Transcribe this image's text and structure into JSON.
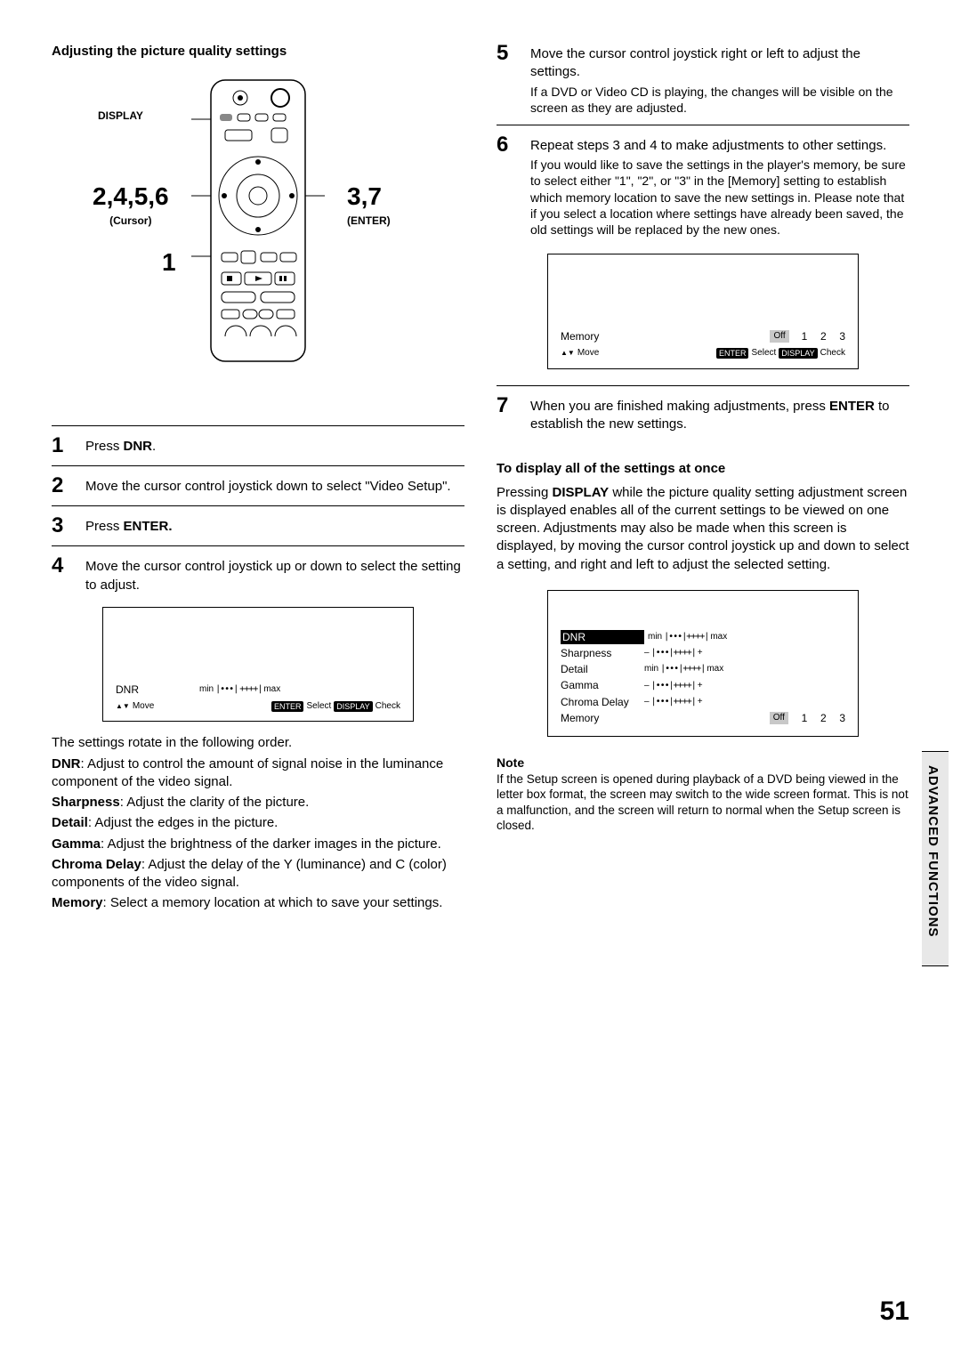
{
  "left": {
    "title": "Adjusting the picture quality settings",
    "callouts": {
      "display": "DISPLAY",
      "cursor_nums": "2,4,5,6",
      "cursor_label": "(Cursor)",
      "enter_nums": "3,7",
      "enter_label": "(ENTER)",
      "one": "1"
    },
    "steps": {
      "s1_pre": "Press ",
      "s1_bold": "DNR",
      "s1_post": ".",
      "s2": "Move the cursor control joystick down to select \"Video Setup\".",
      "s3_pre": "Press ",
      "s3_bold": "ENTER.",
      "s4": "Move the cursor control joystick up or down to select the setting to adjust."
    },
    "osd1": {
      "label": "DNR",
      "min": "min",
      "max": "max",
      "move": "Move",
      "enter": "ENTER",
      "select": "Select",
      "display": "DISPLAY",
      "check": "Check"
    },
    "rotate_intro": "The settings rotate in the following order.",
    "defs": {
      "dnr_label": "DNR",
      "dnr_text": ": Adjust to control the amount of signal noise in the luminance component of the video signal.",
      "sharp_label": "Sharpness",
      "sharp_text": ": Adjust the clarity of the picture.",
      "detail_label": "Detail",
      "detail_text": ": Adjust the edges in the picture.",
      "gamma_label": "Gamma",
      "gamma_text": ": Adjust the brightness of the darker images in the picture.",
      "chroma_label": "Chroma Delay",
      "chroma_text": ": Adjust the delay of the Y (luminance) and C (color) components of the video signal.",
      "memory_label": "Memory",
      "memory_text": ": Select a memory location at which to save your settings."
    }
  },
  "right": {
    "s5_main": "Move the cursor control joystick right or left to adjust the settings.",
    "s5_sub": "If a DVD or Video CD is playing, the changes will be visible on the screen as they are adjusted.",
    "s6_main": "Repeat steps 3 and 4 to make adjustments to other settings.",
    "s6_sub": "If you would like to save the settings in the player's memory, be sure to select either \"1\", \"2\", or \"3\" in the [Memory] setting to establish which memory location to save the new settings in. Please note that if you select a location where settings have already been saved, the old settings will be replaced by the new ones.",
    "osd2": {
      "label": "Memory",
      "off": "Off",
      "n1": "1",
      "n2": "2",
      "n3": "3",
      "move": "Move",
      "enter": "ENTER",
      "select": "Select",
      "display": "DISPLAY",
      "check": "Check"
    },
    "s7_pre": "When you are finished making adjustments, press ",
    "s7_bold": "ENTER",
    "s7_post": " to establish the new settings.",
    "all_heading": "To display all of the settings at once",
    "all_pre": "Pressing ",
    "all_bold": "DISPLAY",
    "all_post": " while the picture quality setting adjustment screen is displayed enables all of the current settings to be viewed on one screen. Adjustments may also be made when this screen is displayed, by moving the cursor control joystick up and down to select a setting, and right and left to adjust the selected setting.",
    "osd3": {
      "dnr": "DNR",
      "sharp": "Sharpness",
      "detail": "Detail",
      "gamma": "Gamma",
      "chroma": "Chroma Delay",
      "memory": "Memory",
      "min": "min",
      "max": "max",
      "minus": "–",
      "plus": "+",
      "off": "Off",
      "n1": "1",
      "n2": "2",
      "n3": "3"
    },
    "note_head": "Note",
    "note_body": "If the Setup screen is opened during playback of a DVD being viewed in the letter box format, the screen may switch to the wide screen format. This is not a malfunction, and the screen will return to normal when the Setup screen is closed."
  },
  "page_number": "51",
  "side_label": "ADVANCED FUNCTIONS"
}
